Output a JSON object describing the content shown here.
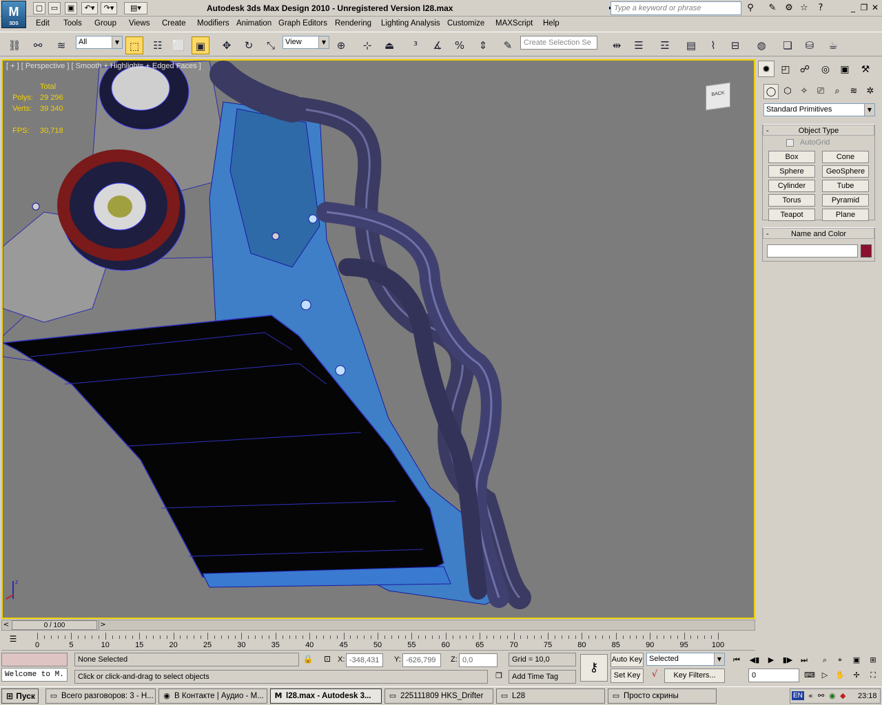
{
  "window": {
    "app_logo": "3DS",
    "title": "Autodesk 3ds Max Design 2010  - Unregistered Version    l28.max",
    "search_placeholder": "Type a keyword or phrase"
  },
  "menu": [
    "Edit",
    "Tools",
    "Group",
    "Views",
    "Create",
    "Modifiers",
    "Animation",
    "Graph Editors",
    "Rendering",
    "Lighting Analysis",
    "Customize",
    "MAXScript",
    "Help"
  ],
  "toolbar": {
    "selection_filter": "All",
    "ref_coord": "View",
    "named_selection_placeholder": "Create Selection Se"
  },
  "viewport": {
    "label": "[ + ] [ Perspective ] [ Smooth + Highlights + Edged Faces ]",
    "stats": {
      "header": "Total",
      "polys_label": "Polys:",
      "polys": "29 296",
      "verts_label": "Verts:",
      "verts": "39 340",
      "fps_label": "FPS:",
      "fps": "30,718"
    },
    "viewcube_label": "BACK",
    "axis_z": "z"
  },
  "command_panel": {
    "category": "Standard Primitives",
    "object_type": {
      "title": "Object Type",
      "autogrid": "AutoGrid",
      "buttons": [
        "Box",
        "Cone",
        "Sphere",
        "GeoSphere",
        "Cylinder",
        "Tube",
        "Torus",
        "Pyramid",
        "Teapot",
        "Plane"
      ]
    },
    "name_color": {
      "title": "Name and Color",
      "name_value": "",
      "color": "#8b0f2f"
    }
  },
  "timeline": {
    "slider": "0 / 100",
    "ticks": [
      "0",
      "5",
      "10",
      "15",
      "20",
      "25",
      "30",
      "35",
      "40",
      "45",
      "50",
      "55",
      "60",
      "65",
      "70",
      "75",
      "80",
      "85",
      "90",
      "95",
      "100"
    ]
  },
  "status": {
    "selection": "None Selected",
    "prompt": "Click or click-and-drag to select objects",
    "listener": "Welcome to M.",
    "x_label": "X:",
    "x": "-348,431",
    "y_label": "Y:",
    "y": "-626,799",
    "z_label": "Z:",
    "z": "0,0",
    "grid": "Grid = 10,0",
    "add_time_tag": "Add Time Tag",
    "auto_key": "Auto Key",
    "set_key": "Set Key",
    "key_mode": "Selected",
    "key_filters": "Key Filters...",
    "frame": "0"
  },
  "taskbar": {
    "start": "Пуск",
    "tasks": [
      {
        "label": "Всего разговоров: 3 - Н...",
        "icon": "folder-icon"
      },
      {
        "label": "В Контакте | Аудио - М...",
        "icon": "firefox-icon"
      },
      {
        "label": "l28.max - Autodesk 3...",
        "icon": "max-icon"
      },
      {
        "label": "225111809 HKS_Drifter",
        "icon": "folder-icon"
      },
      {
        "label": "L28",
        "icon": "folder-icon"
      },
      {
        "label": "Просто скрины",
        "icon": "folder-icon"
      }
    ],
    "lang": "EN",
    "clock": "23:18"
  }
}
